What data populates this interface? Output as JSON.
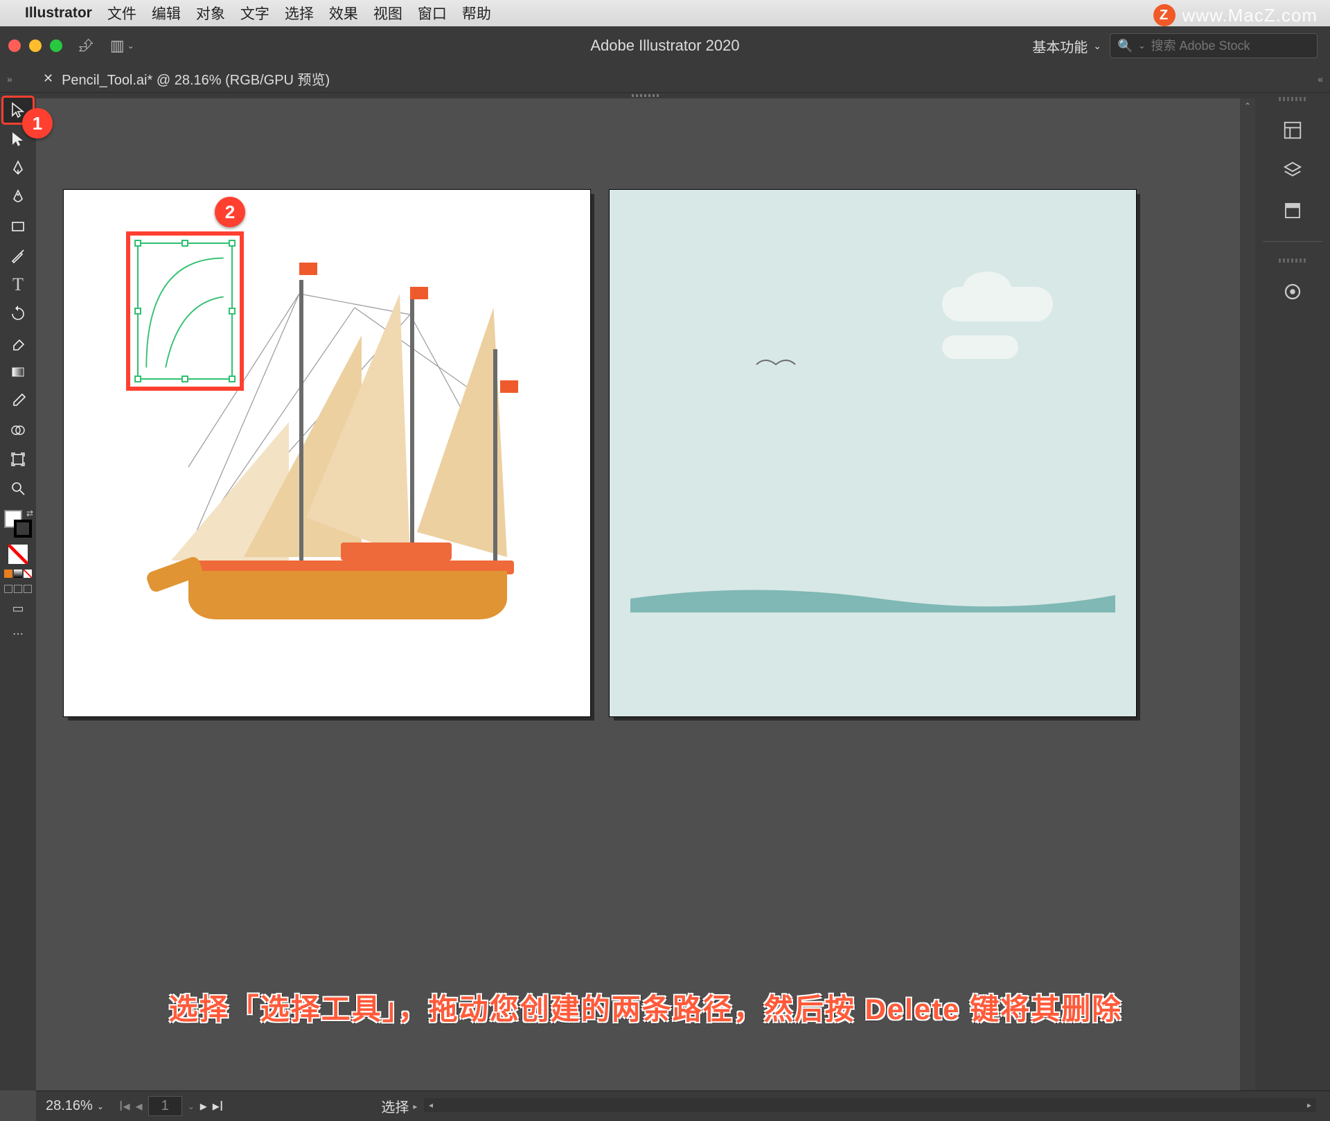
{
  "mac_menu": {
    "app_name": "Illustrator",
    "items": [
      "文件",
      "编辑",
      "对象",
      "文字",
      "选择",
      "效果",
      "视图",
      "窗口",
      "帮助"
    ]
  },
  "watermark": {
    "badge": "Z",
    "text": "www.MacZ.com"
  },
  "titlebar": {
    "title": "Adobe Illustrator 2020",
    "workspace": "基本功能",
    "search_placeholder": "搜索 Adobe Stock"
  },
  "document_tab": {
    "label": "Pencil_Tool.ai* @ 28.16% (RGB/GPU 预览)"
  },
  "tools": {
    "list": [
      {
        "name": "selection-tool",
        "glyph": "▲",
        "selected": true
      },
      {
        "name": "direct-selection-tool",
        "glyph": "◁"
      },
      {
        "name": "pen-tool",
        "glyph": "✒"
      },
      {
        "name": "curvature-tool",
        "glyph": "〰"
      },
      {
        "name": "rectangle-tool",
        "glyph": "▭"
      },
      {
        "name": "paintbrush-tool",
        "glyph": "✎"
      },
      {
        "name": "type-tool",
        "glyph": "T"
      },
      {
        "name": "rotate-tool",
        "glyph": "↻"
      },
      {
        "name": "eraser-tool",
        "glyph": "◧"
      },
      {
        "name": "gradient-tool",
        "glyph": "▤"
      },
      {
        "name": "eyedropper-tool",
        "glyph": "✐"
      },
      {
        "name": "shapebuilder-tool",
        "glyph": "◎"
      },
      {
        "name": "artboard-tool",
        "glyph": "▢"
      },
      {
        "name": "zoom-tool",
        "glyph": "🔍"
      }
    ]
  },
  "right_panel": {
    "icons": [
      {
        "name": "properties-icon",
        "glyph": "◫"
      },
      {
        "name": "layers-icon",
        "glyph": "❖"
      },
      {
        "name": "libraries-icon",
        "glyph": "▣"
      },
      {
        "name": "divider",
        "glyph": ""
      },
      {
        "name": "comments-icon",
        "glyph": "◉"
      }
    ]
  },
  "callouts": {
    "badge1": "1",
    "badge2": "2"
  },
  "instruction": "选择「选择工具」，拖动您创建的两条路径，然后按 Delete 键将其删除",
  "statusbar": {
    "zoom": "28.16%",
    "artboard_number": "1",
    "status_label": "选择"
  }
}
